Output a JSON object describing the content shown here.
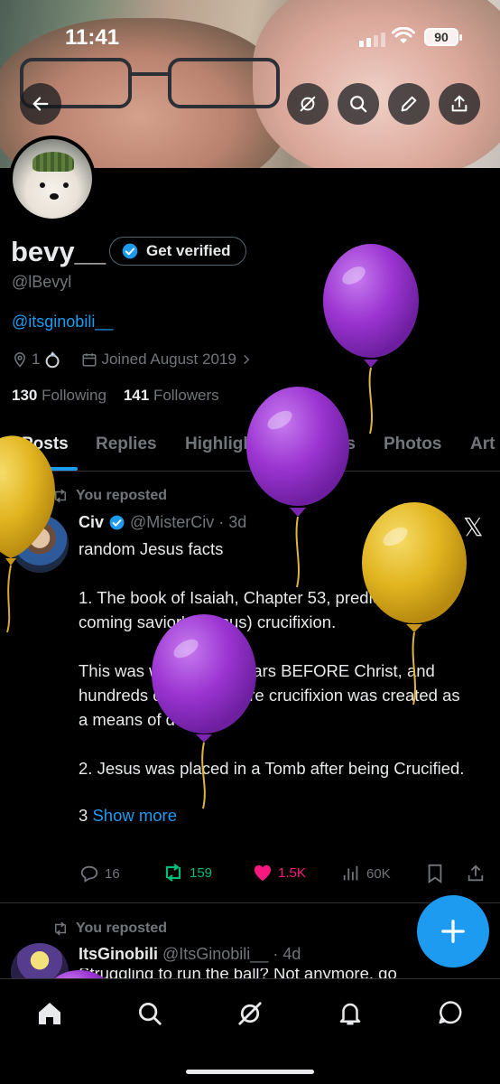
{
  "status_bar": {
    "time": "11:41",
    "battery": "90"
  },
  "profile": {
    "name": "bevy__",
    "verify_label": "Get verified",
    "handle": "@lBevyl",
    "bio_link": "@itsginobili__",
    "location": "1",
    "joined": "Joined August 2019",
    "following_count": "130",
    "following_label": "Following",
    "followers_count": "141",
    "followers_label": "Followers"
  },
  "tabs": [
    "Posts",
    "Replies",
    "Highlights",
    "Videos",
    "Photos",
    "Art"
  ],
  "posts": [
    {
      "repost_label": "You reposted",
      "author": "Civ",
      "handle": "@MisterCiv",
      "time": "· 3d",
      "paragraphs": [
        "random Jesus facts",
        "1. The book of Isaiah, Chapter 53, predicts the coming savior's (Jesus) crucifixion.",
        "This was written 700 years BEFORE Christ, and hundreds of years before crucifixion was created as a means of death",
        "2. Jesus was placed in a Tomb after being Crucified."
      ],
      "truncated_prefix": "3",
      "show_more": "Show more",
      "replies": "16",
      "reposts": "159",
      "likes": "1.5K",
      "views": "60K"
    },
    {
      "repost_label": "You reposted",
      "author": "ItsGinobili",
      "handle": "@ItsGinobili__",
      "time": "· 4d",
      "preview": "Struggling to run the ball? Not anymore, go"
    }
  ],
  "colors": {
    "accent": "#1d9bf0",
    "repost_green": "#00ba7c",
    "like_pink": "#f91880",
    "balloon_purple": "#9b35d1",
    "balloon_gold": "#e2b520"
  }
}
